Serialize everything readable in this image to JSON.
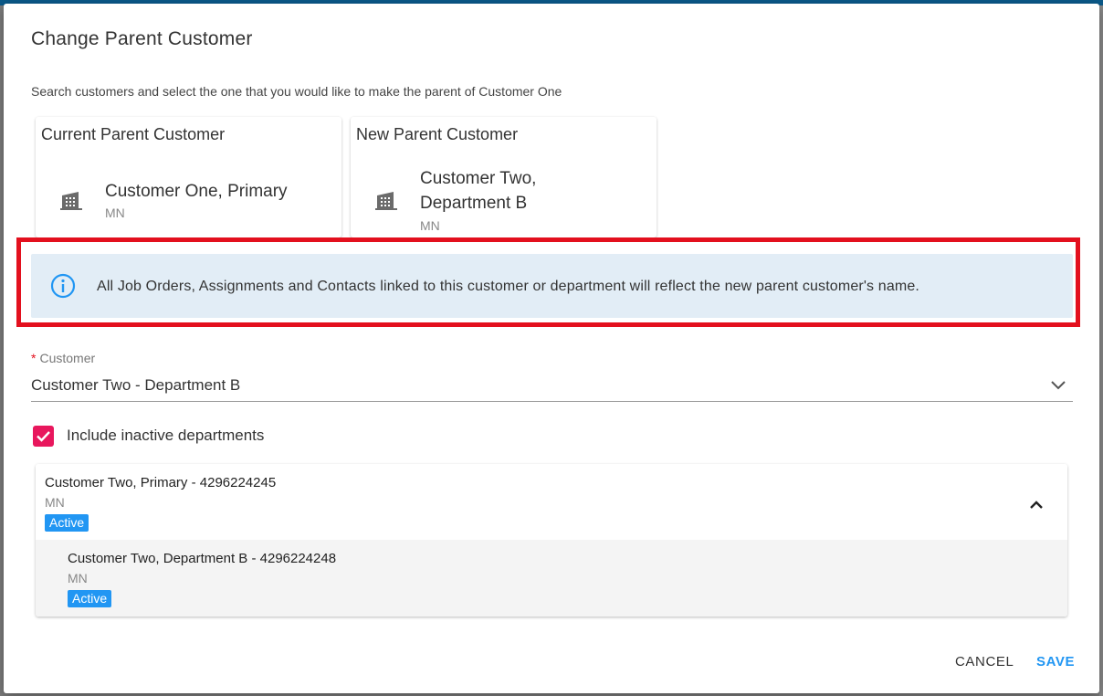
{
  "dialog": {
    "title": "Change Parent Customer",
    "instruction": "Search customers and select the one that you would like to make the parent of Customer One"
  },
  "current_parent": {
    "header": "Current Parent Customer",
    "name": "Customer One, Primary",
    "state": "MN",
    "icon": "building-icon"
  },
  "new_parent": {
    "header": "New Parent Customer",
    "name": "Customer Two, Department B",
    "state": "MN",
    "icon": "building-icon"
  },
  "alert": {
    "icon": "info-icon",
    "text": "All Job Orders, Assignments and Contacts linked to this customer or department will reflect the new parent customer's name.",
    "highlight_color": "#e3101e",
    "background": "#e2edf6"
  },
  "customer_field": {
    "required_marker": "*",
    "label": "Customer",
    "value": "Customer Two - Department B"
  },
  "include_inactive": {
    "label": "Include inactive departments",
    "checked": true,
    "color": "#e8175d"
  },
  "results": [
    {
      "title": "Customer Two, Primary - 4296224245",
      "state": "MN",
      "status": "Active",
      "expanded": true
    },
    {
      "title": "Customer Two, Department B - 4296224248",
      "state": "MN",
      "status": "Active"
    }
  ],
  "footer": {
    "cancel_label": "CANCEL",
    "save_label": "SAVE"
  },
  "colors": {
    "accent": "#2196f3",
    "badge": "#2196f3"
  }
}
